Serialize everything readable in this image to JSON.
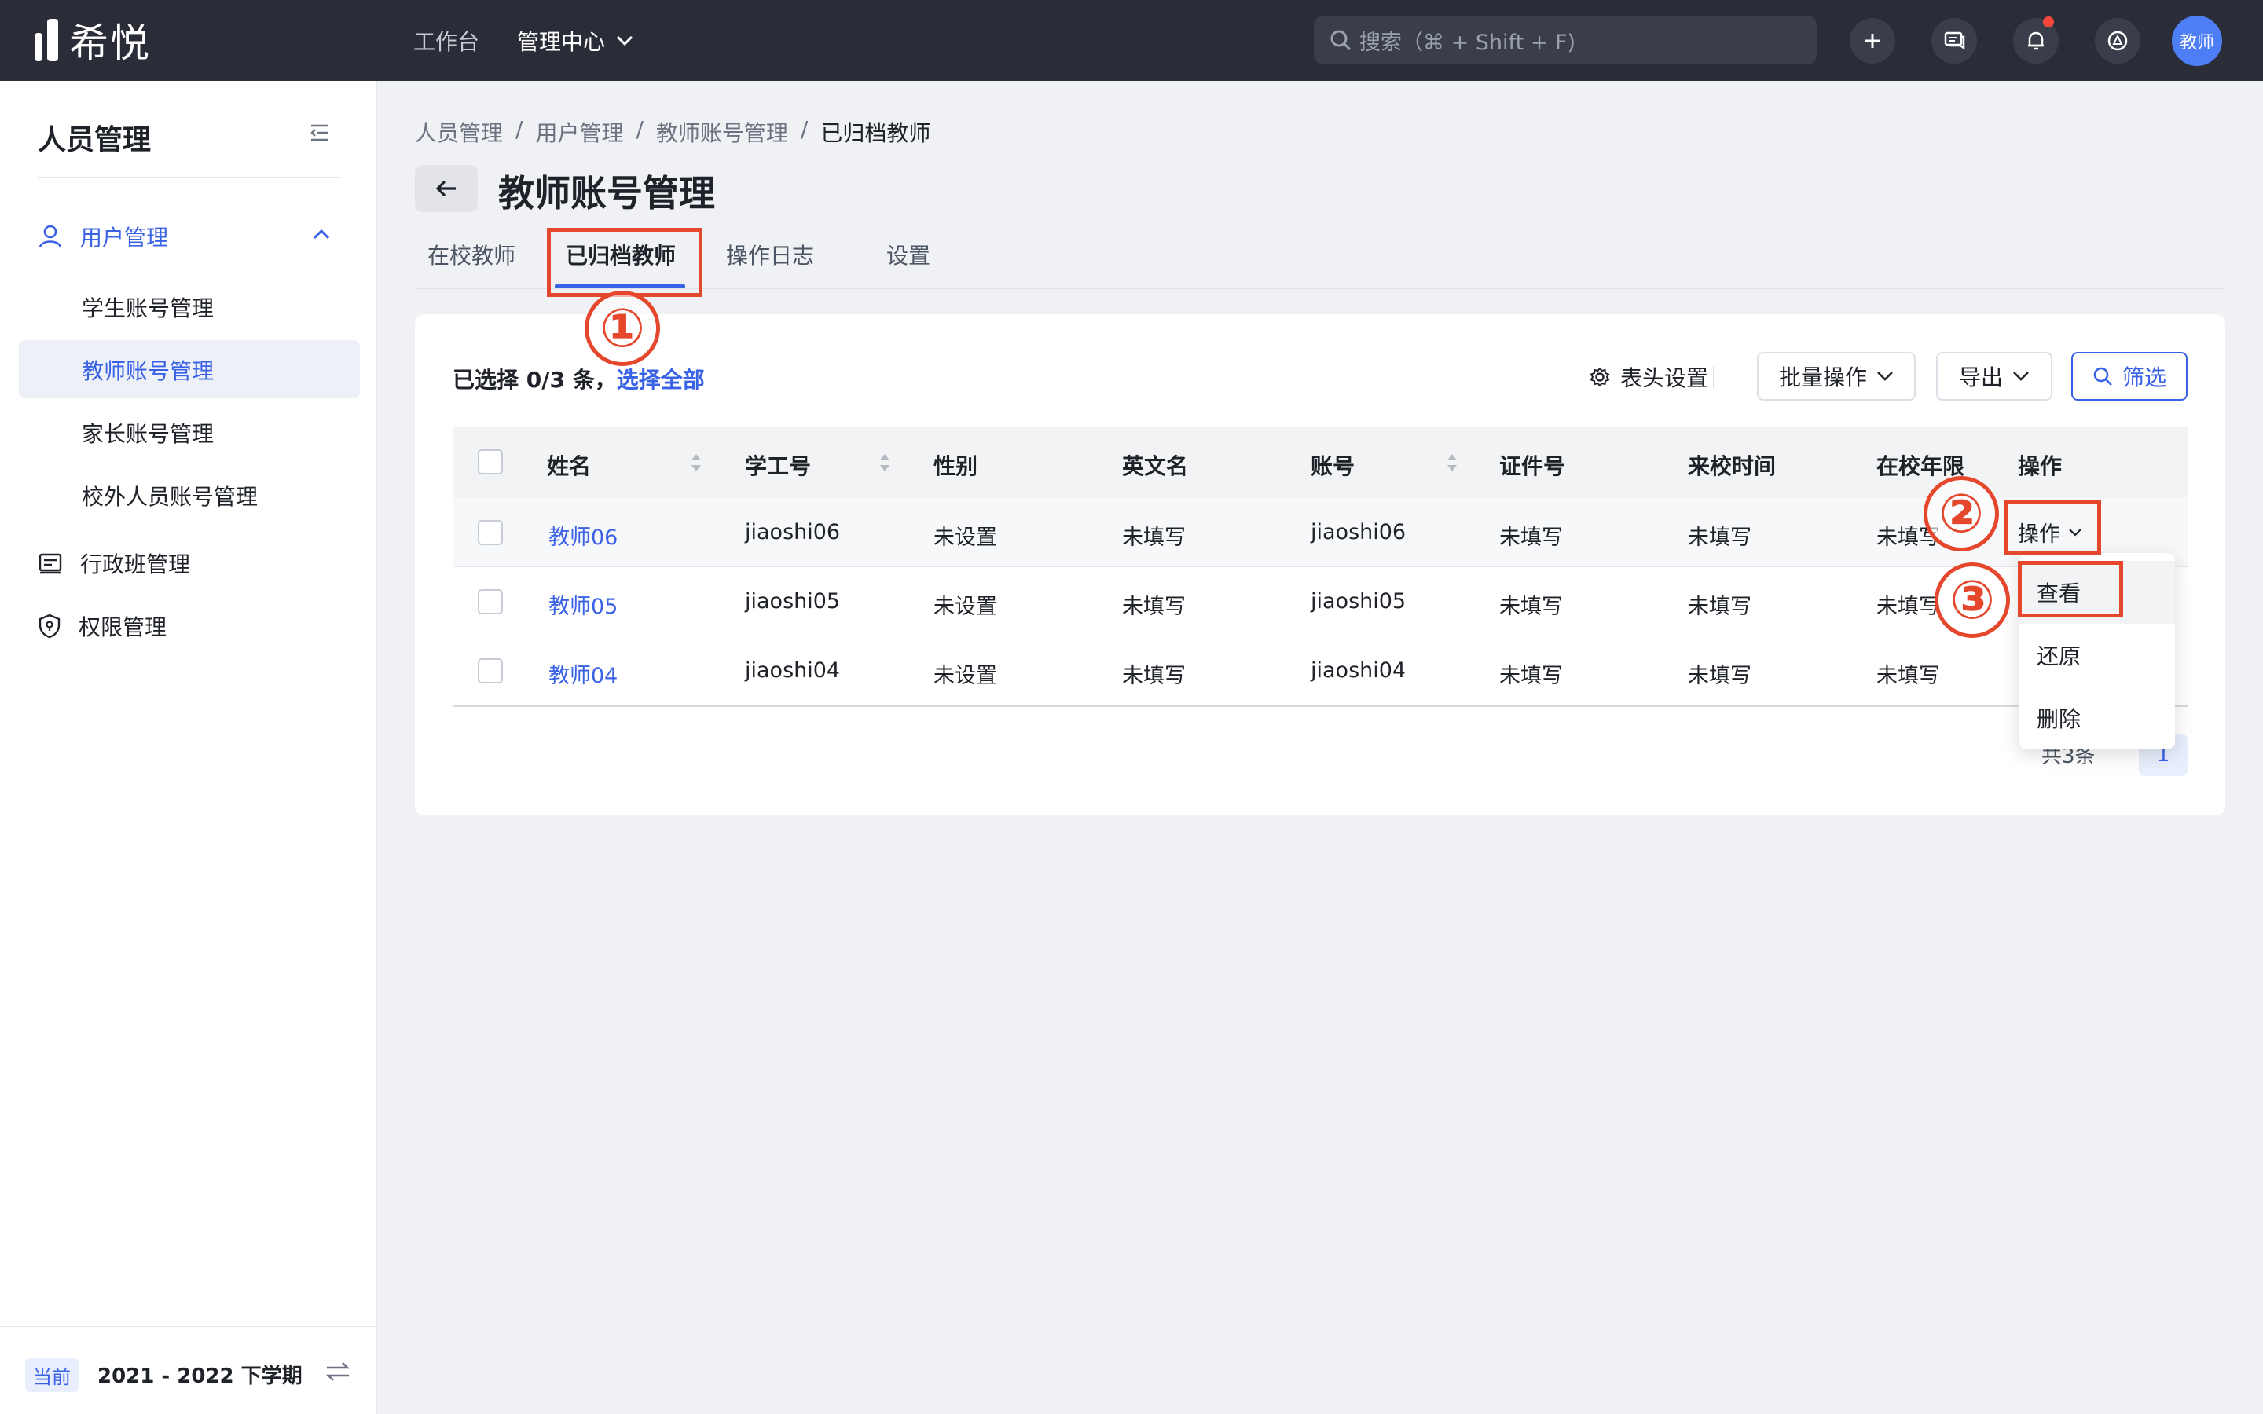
{
  "app": {
    "name": "希悦"
  },
  "topbar": {
    "nav_workbench": "工作台",
    "nav_admin": "管理中心",
    "search_placeholder": "搜索（⌘ + Shift + F)",
    "avatar_text": "教师"
  },
  "sidebar": {
    "title": "人员管理",
    "group_user": "用户管理",
    "items": [
      {
        "label": "学生账号管理"
      },
      {
        "label": "教师账号管理"
      },
      {
        "label": "家长账号管理"
      },
      {
        "label": "校外人员账号管理"
      }
    ],
    "group_class": "行政班管理",
    "group_perm": "权限管理",
    "term_badge": "当前",
    "term_text": "2021 - 2022 下学期"
  },
  "breadcrumb": [
    "人员管理",
    "用户管理",
    "教师账号管理",
    "已归档教师"
  ],
  "breadcrumb_sep": "/",
  "page_title": "教师账号管理",
  "tabs": [
    {
      "label": "在校教师"
    },
    {
      "label": "已归档教师"
    },
    {
      "label": "操作日志"
    },
    {
      "label": "设置"
    }
  ],
  "toolbar": {
    "selected_prefix": "已选择 0/3 条，",
    "select_all": "选择全部",
    "head_setting": "表头设置",
    "batch": "批量操作",
    "export": "导出",
    "filter": "筛选"
  },
  "table": {
    "columns": [
      "姓名",
      "学工号",
      "性别",
      "英文名",
      "账号",
      "证件号",
      "来校时间",
      "在校年限",
      "操作"
    ],
    "rows": [
      {
        "name": "教师06",
        "id": "jiaoshi06",
        "gender": "未设置",
        "en": "未填写",
        "account": "jiaoshi06",
        "cert": "未填写",
        "arrival": "未填写",
        "years": "未填写"
      },
      {
        "name": "教师05",
        "id": "jiaoshi05",
        "gender": "未设置",
        "en": "未填写",
        "account": "jiaoshi05",
        "cert": "未填写",
        "arrival": "未填写",
        "years": "未填写"
      },
      {
        "name": "教师04",
        "id": "jiaoshi04",
        "gender": "未设置",
        "en": "未填写",
        "account": "jiaoshi04",
        "cert": "未填写",
        "arrival": "未填写",
        "years": "未填写"
      }
    ],
    "op_trigger": "操作"
  },
  "dropdown": [
    "查看",
    "还原",
    "删除"
  ],
  "pager": {
    "total": "共3条",
    "page": "1"
  },
  "annotations": [
    "①",
    "②",
    "③"
  ],
  "colors": {
    "accent": "#3a62e6",
    "annotation": "#e4472c",
    "topbar": "#2a2d38"
  }
}
